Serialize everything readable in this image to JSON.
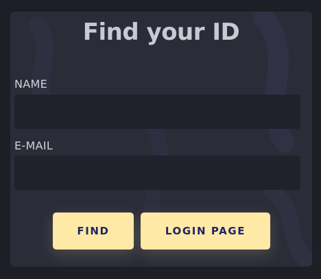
{
  "form": {
    "title": "Find your ID",
    "name_label": "NAME",
    "name_value": "",
    "email_label": "E-MAIL",
    "email_value": ""
  },
  "buttons": {
    "find_label": "FIND",
    "login_label": "LOGIN PAGE"
  },
  "colors": {
    "page_background": "#1e1e26",
    "card_background": "#2b2c38",
    "field_background": "#20212b",
    "button_background": "#ffe9a6",
    "button_text": "#1d2566",
    "title_text": "#c9c9d3"
  }
}
